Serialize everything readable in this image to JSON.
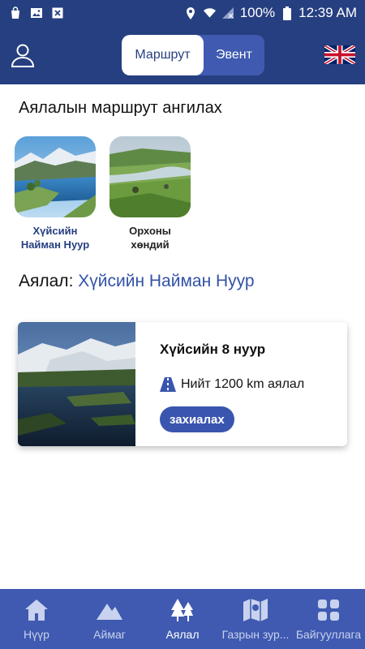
{
  "status_bar": {
    "battery": "100%",
    "time": "12:39 AM",
    "icons": [
      "shopping-bag-icon",
      "image-icon",
      "close-box-icon",
      "location-icon",
      "wifi-icon",
      "signal-icon",
      "battery-icon"
    ]
  },
  "header": {
    "tabs": [
      {
        "label": "Маршрут",
        "active": true
      },
      {
        "label": "Эвент",
        "active": false
      }
    ],
    "profile_icon": "user-icon",
    "language_icon": "uk-flag-icon"
  },
  "categories": {
    "title": "Аялалын маршрут ангилах",
    "items": [
      {
        "label": "Хүйсийн Найман Нуур",
        "selected": true
      },
      {
        "label": "Орхоны хөндий",
        "selected": false
      }
    ]
  },
  "trip": {
    "prefix": "Аялал:",
    "name": "Хүйсийн Найман Нуур"
  },
  "route_card": {
    "title": "Хүйсийн 8 нуур",
    "distance": "Нийт 1200 km аялал",
    "distance_icon": "road-icon",
    "book_label": "захиалах"
  },
  "bottom_nav": {
    "items": [
      {
        "label": "Нүүр",
        "icon": "home-icon",
        "active": false
      },
      {
        "label": "Аймаг",
        "icon": "mountain-icon",
        "active": false
      },
      {
        "label": "Аялал",
        "icon": "trees-icon",
        "active": true
      },
      {
        "label": "Газрын зур...",
        "icon": "map-icon",
        "active": false
      },
      {
        "label": "Байгууллага",
        "icon": "grid-icon",
        "active": false
      }
    ]
  },
  "colors": {
    "primary": "#263f80",
    "nav_bg": "#3f5ab0",
    "accent_text": "#3252a8",
    "button": "#3a55ae"
  }
}
